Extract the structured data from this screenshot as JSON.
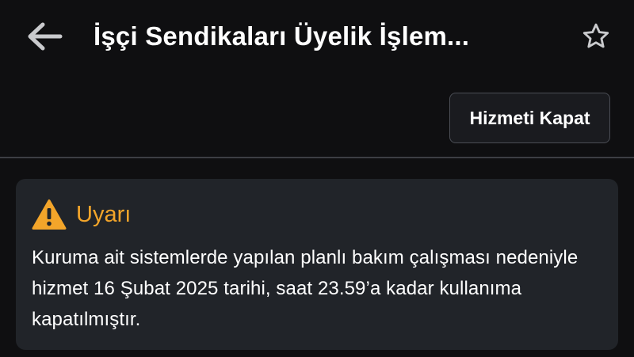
{
  "header": {
    "title": "İşçi Sendikaları Üyelik İşlem...",
    "back_icon": "arrow-left-icon",
    "favorite_icon": "star-outline-icon"
  },
  "actions": {
    "close_service_label": "Hizmeti Kapat"
  },
  "warning": {
    "icon": "warning-triangle-icon",
    "title": "Uyarı",
    "message": "Kuruma ait sistemlerde yapılan planlı bakım çalışması nedeniyle hizmet 16 Şubat 2025 tarihi, saat 23.59’a kadar kullanıma kapatılmıştır."
  },
  "colors": {
    "background": "#0f0f11",
    "card": "#212429",
    "warning_accent": "#f3a52a",
    "button_border": "#4b4e55"
  }
}
